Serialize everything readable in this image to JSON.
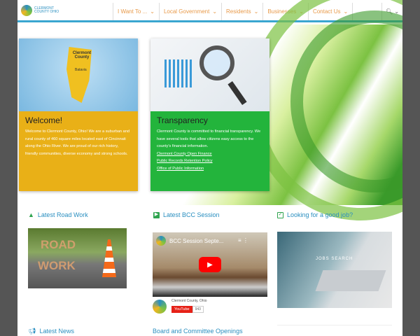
{
  "header": {
    "logo_text": "CLERMONT COUNTY OHIO",
    "nav": [
      "I Want To ...",
      "Local Government",
      "Residents",
      "Businesses",
      "Contact Us"
    ],
    "search_icon": "search-icon"
  },
  "welcome": {
    "title": "Welcome!",
    "text": "Welcome to Clermont County, Ohio! We are a suburban and rural county of 460 square miles located east of Cincinnati along the Ohio River. We are proud of our rich history, friendly communities, diverse economy and strong schools.",
    "map_label": "Clermont County",
    "map_town": "Batavia"
  },
  "transparency": {
    "title": "Transparency",
    "text": "Clermont County is committed to financial transparency. We have several tools that allow citizens easy access to the county's financial information.",
    "links": [
      "Clermont County Open Finance",
      "Public Records Retention Policy",
      "Office of Public Information"
    ]
  },
  "sections": {
    "road": "Latest Road Work",
    "bcc": "Latest BCC Session",
    "job": "Looking for a good job?",
    "news": "Latest News",
    "board": "Board and Committee Openings"
  },
  "road_img_text": [
    "ROAD",
    "WORK"
  ],
  "video": {
    "title": "BCC Session Septe...",
    "channel": "Clermont County, Ohio",
    "youtube": "YouTube",
    "subs": "943"
  },
  "job_img_text": "JOBS SEARCH"
}
